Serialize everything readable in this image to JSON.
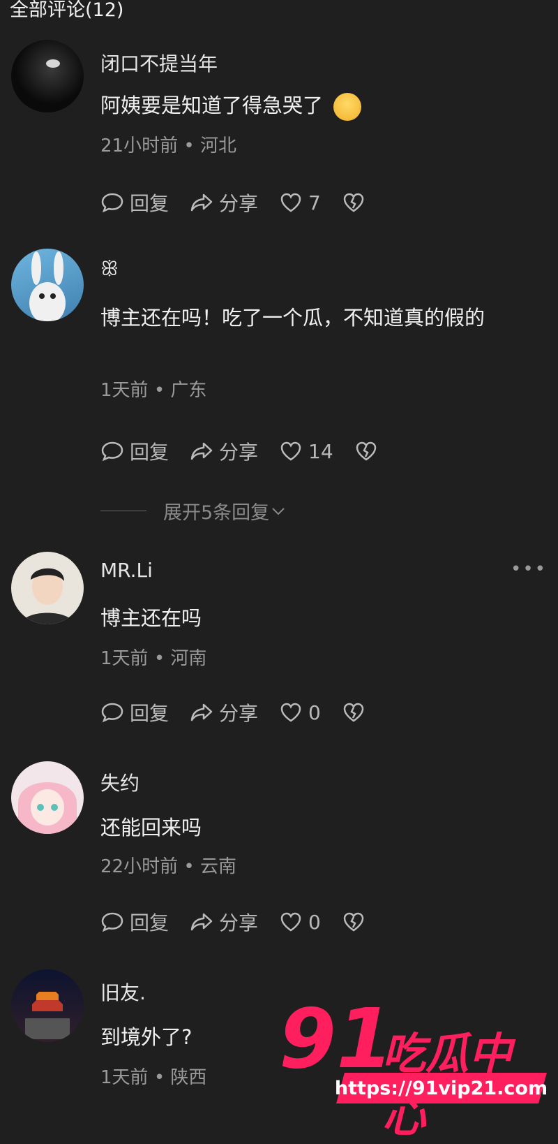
{
  "header": {
    "title": "全部评论(12)"
  },
  "actions": {
    "reply_label": "回复",
    "share_label": "分享"
  },
  "comments": [
    {
      "username": "闭口不提当年",
      "text": "阿姨要是知道了得急哭了",
      "time": "21小时前",
      "location": "河北",
      "likes": "7"
    },
    {
      "username": "ꕥ",
      "text": "博主还在吗！吃了一个瓜，不知道真的假的",
      "time": "1天前",
      "location": "广东",
      "likes": "14",
      "expand_label": "展开5条回复"
    },
    {
      "username": "MR.Li",
      "text": "博主还在吗",
      "time": "1天前",
      "location": "河南",
      "likes": "0"
    },
    {
      "username": "失约",
      "text": "还能回来吗",
      "time": "22小时前",
      "location": "云南",
      "likes": "0"
    },
    {
      "username": "旧友.",
      "text": "到境外了?",
      "time": "1天前",
      "location": "陕西"
    }
  ],
  "more_menu": "•••",
  "separator": "•",
  "watermark": {
    "number": "91",
    "title": "吃瓜中心",
    "url": "https://91vip21.com"
  },
  "colors": {
    "background": "#1f1f1f",
    "watermark": "#ff1f5e"
  }
}
